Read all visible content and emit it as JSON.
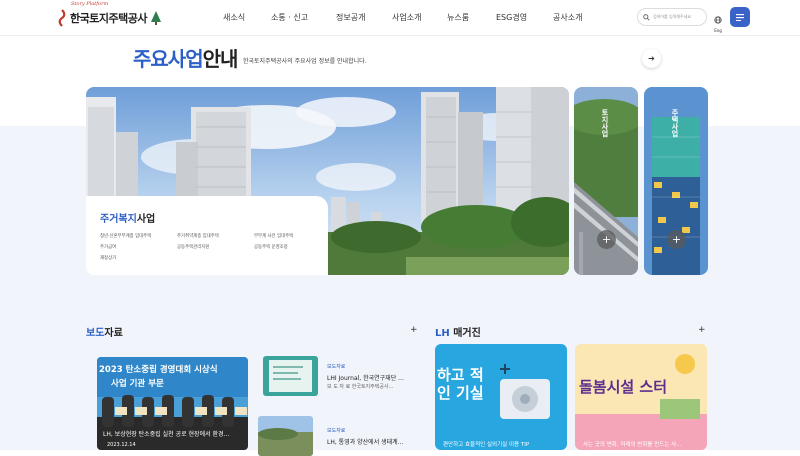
{
  "header": {
    "logo_text": "한국토지주택공사",
    "logo_script": "Story Platform",
    "nav": [
      "새소식",
      "소통 · 신고",
      "정보공개",
      "사업소개",
      "뉴스룸",
      "ESG경영",
      "공사소개"
    ],
    "search_placeholder": "검색어를 입력해주세요",
    "lang_label": "Eng"
  },
  "section": {
    "title_blue": "주요사업",
    "title_rest": "안내",
    "description": "한국토지주택공사의 주요사업 정보를 안내합니다."
  },
  "main_card": {
    "title_blue": "주거복지",
    "title_rest": "사업",
    "items": [
      "청년·신혼부부계층 임대주택",
      "주거취약계층 임대주택",
      "부부계 사전 임대주택",
      "주거급여",
      "공동주택관리지원",
      "공동주택 운영조정",
      "재정상가"
    ]
  },
  "side_cards": [
    {
      "label": "토지사업"
    },
    {
      "label": "주택사업"
    }
  ],
  "press": {
    "heading_blue": "보도",
    "heading_rest": "자료",
    "featured_caption": "LH, 보상현장 탄소중립 실천 공로 현장에서 환경...",
    "featured_date": "2023.12.14",
    "featured_banner_line1": "2023 탄소중립 경영대회 시상식",
    "featured_banner_line2": "사업 기관 부문",
    "items": [
      {
        "tag": "보도자료",
        "title": "LHI Journal, 한국연구재단 ...",
        "sub": "보 도 자 료 한국토지주택공사..."
      },
      {
        "tag": "보도자료",
        "title": "LH, 통영과 양산에서 생태계...",
        "sub": ""
      }
    ]
  },
  "magazine": {
    "heading_rest": "매거진",
    "heading_prefix": "LH",
    "cards": [
      {
        "caption": "편안하고 효율적인 실외기실 이용 TIP",
        "banner": "하고 적인 기실"
      },
      {
        "caption": "사는 곳의 변화, 미래의 변화를 만드는 사...",
        "banner": "돌봄시설 스터"
      }
    ]
  },
  "colors": {
    "accent": "#2d5fc8",
    "menu_button": "#3a63c9",
    "page_bg": "#f1f4fb"
  },
  "icons": [
    "search-icon",
    "globe-icon",
    "menu-icon",
    "arrow-right-icon",
    "plus-icon"
  ]
}
